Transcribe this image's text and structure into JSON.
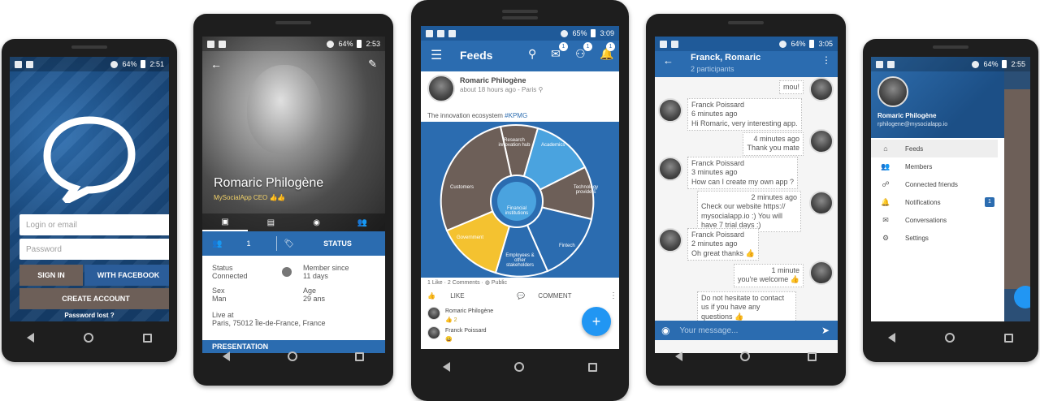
{
  "status_bars": {
    "login": {
      "battery": "64%",
      "time": "2:51"
    },
    "profile": {
      "battery": "64%",
      "time": "2:53"
    },
    "feeds": {
      "battery": "65%",
      "time": "3:09"
    },
    "chat": {
      "battery": "64%",
      "time": "3:05"
    },
    "drawer": {
      "battery": "64%",
      "time": "2:55"
    }
  },
  "login": {
    "email_placeholder": "Login or email",
    "password_placeholder": "Password",
    "sign_in": "SIGN IN",
    "with_facebook": "WITH FACEBOOK",
    "create_account": "CREATE ACCOUNT",
    "forgot_password": "Password lost ?"
  },
  "profile": {
    "name": "Romaric Philogène",
    "subtitle": "MySocialApp CEO 👍👍",
    "friends_count": "1",
    "status_button": "STATUS",
    "status_label": "Status",
    "status_value": "Connected",
    "member_since_label": "Member since",
    "member_since_value": "11 days",
    "sex_label": "Sex",
    "sex_value": "Man",
    "age_label": "Age",
    "age_value": "29 ans",
    "live_at_label": "Live at",
    "live_at_value": "Paris, 75012 Île-de-France, France",
    "presentation": "PRESENTATION"
  },
  "feeds": {
    "title": "Feeds",
    "badges": [
      "1",
      "1",
      "1"
    ],
    "post_author": "Romaric Philogène",
    "post_time": "about 18 hours ago - Paris",
    "post_text": "The innovation ecosystem ",
    "post_hashtag": "#KPMG",
    "wheel": {
      "segments": [
        "Research innovation hub",
        "Academics",
        "Technology providers",
        "Fintech",
        "Employees & other stakeholders",
        "Government",
        "Customers"
      ],
      "center": "Financial institutions"
    },
    "likes": "1 Like",
    "comments": "2 Comments",
    "visibility": "Public",
    "like_btn": "LIKE",
    "comment_btn": "COMMENT",
    "comment1_author": "Romaric Philogène",
    "comment1_text": "👍 2",
    "comment2_author": "Franck Poissard",
    "comment2_text": "😀",
    "fab": "+"
  },
  "chat": {
    "title": "Franck, Romaric",
    "subtitle": "2 participants",
    "messages": [
      {
        "side": "right",
        "time": "",
        "text": "mou!"
      },
      {
        "side": "left",
        "author": "Franck Poissard",
        "time": "6 minutes ago",
        "text": "Hi Romaric, very interesting app."
      },
      {
        "side": "right",
        "time": "4 minutes ago",
        "text": "Thank you mate"
      },
      {
        "side": "left",
        "author": "Franck Poissard",
        "time": "3 minutes ago",
        "text": "How can I create my own app ?"
      },
      {
        "side": "right",
        "time": "2 minutes ago",
        "text": "Check our website https:// mysocialapp.io :) You will have 7 trial days :)"
      },
      {
        "side": "left",
        "author": "Franck Poissard",
        "time": "2 minutes ago",
        "text": "Oh great thanks 👍"
      },
      {
        "side": "right",
        "time": "1 minute",
        "text": "you're welcome 👍"
      },
      {
        "side": "right",
        "time": "",
        "text": "Do not hesitate to contact us if you have any questions 👍"
      }
    ],
    "input_placeholder": "Your message..."
  },
  "drawer": {
    "name": "Romaric Philogène",
    "email": "rphilogene@mysocialapp.io",
    "items": [
      {
        "icon": "home-icon",
        "label": "Feeds",
        "badge": ""
      },
      {
        "icon": "people-icon",
        "label": "Members",
        "badge": ""
      },
      {
        "icon": "connected-friends-icon",
        "label": "Connected friends",
        "badge": ""
      },
      {
        "icon": "bell-icon",
        "label": "Notifications",
        "badge": "1"
      },
      {
        "icon": "mail-icon",
        "label": "Conversations",
        "badge": ""
      },
      {
        "icon": "gear-icon",
        "label": "Settings",
        "badge": ""
      }
    ]
  },
  "colors": {
    "primary": "#2b6cb0",
    "accent": "#2196f3",
    "brown": "#6d5f58",
    "yellow": "#f4c230"
  }
}
